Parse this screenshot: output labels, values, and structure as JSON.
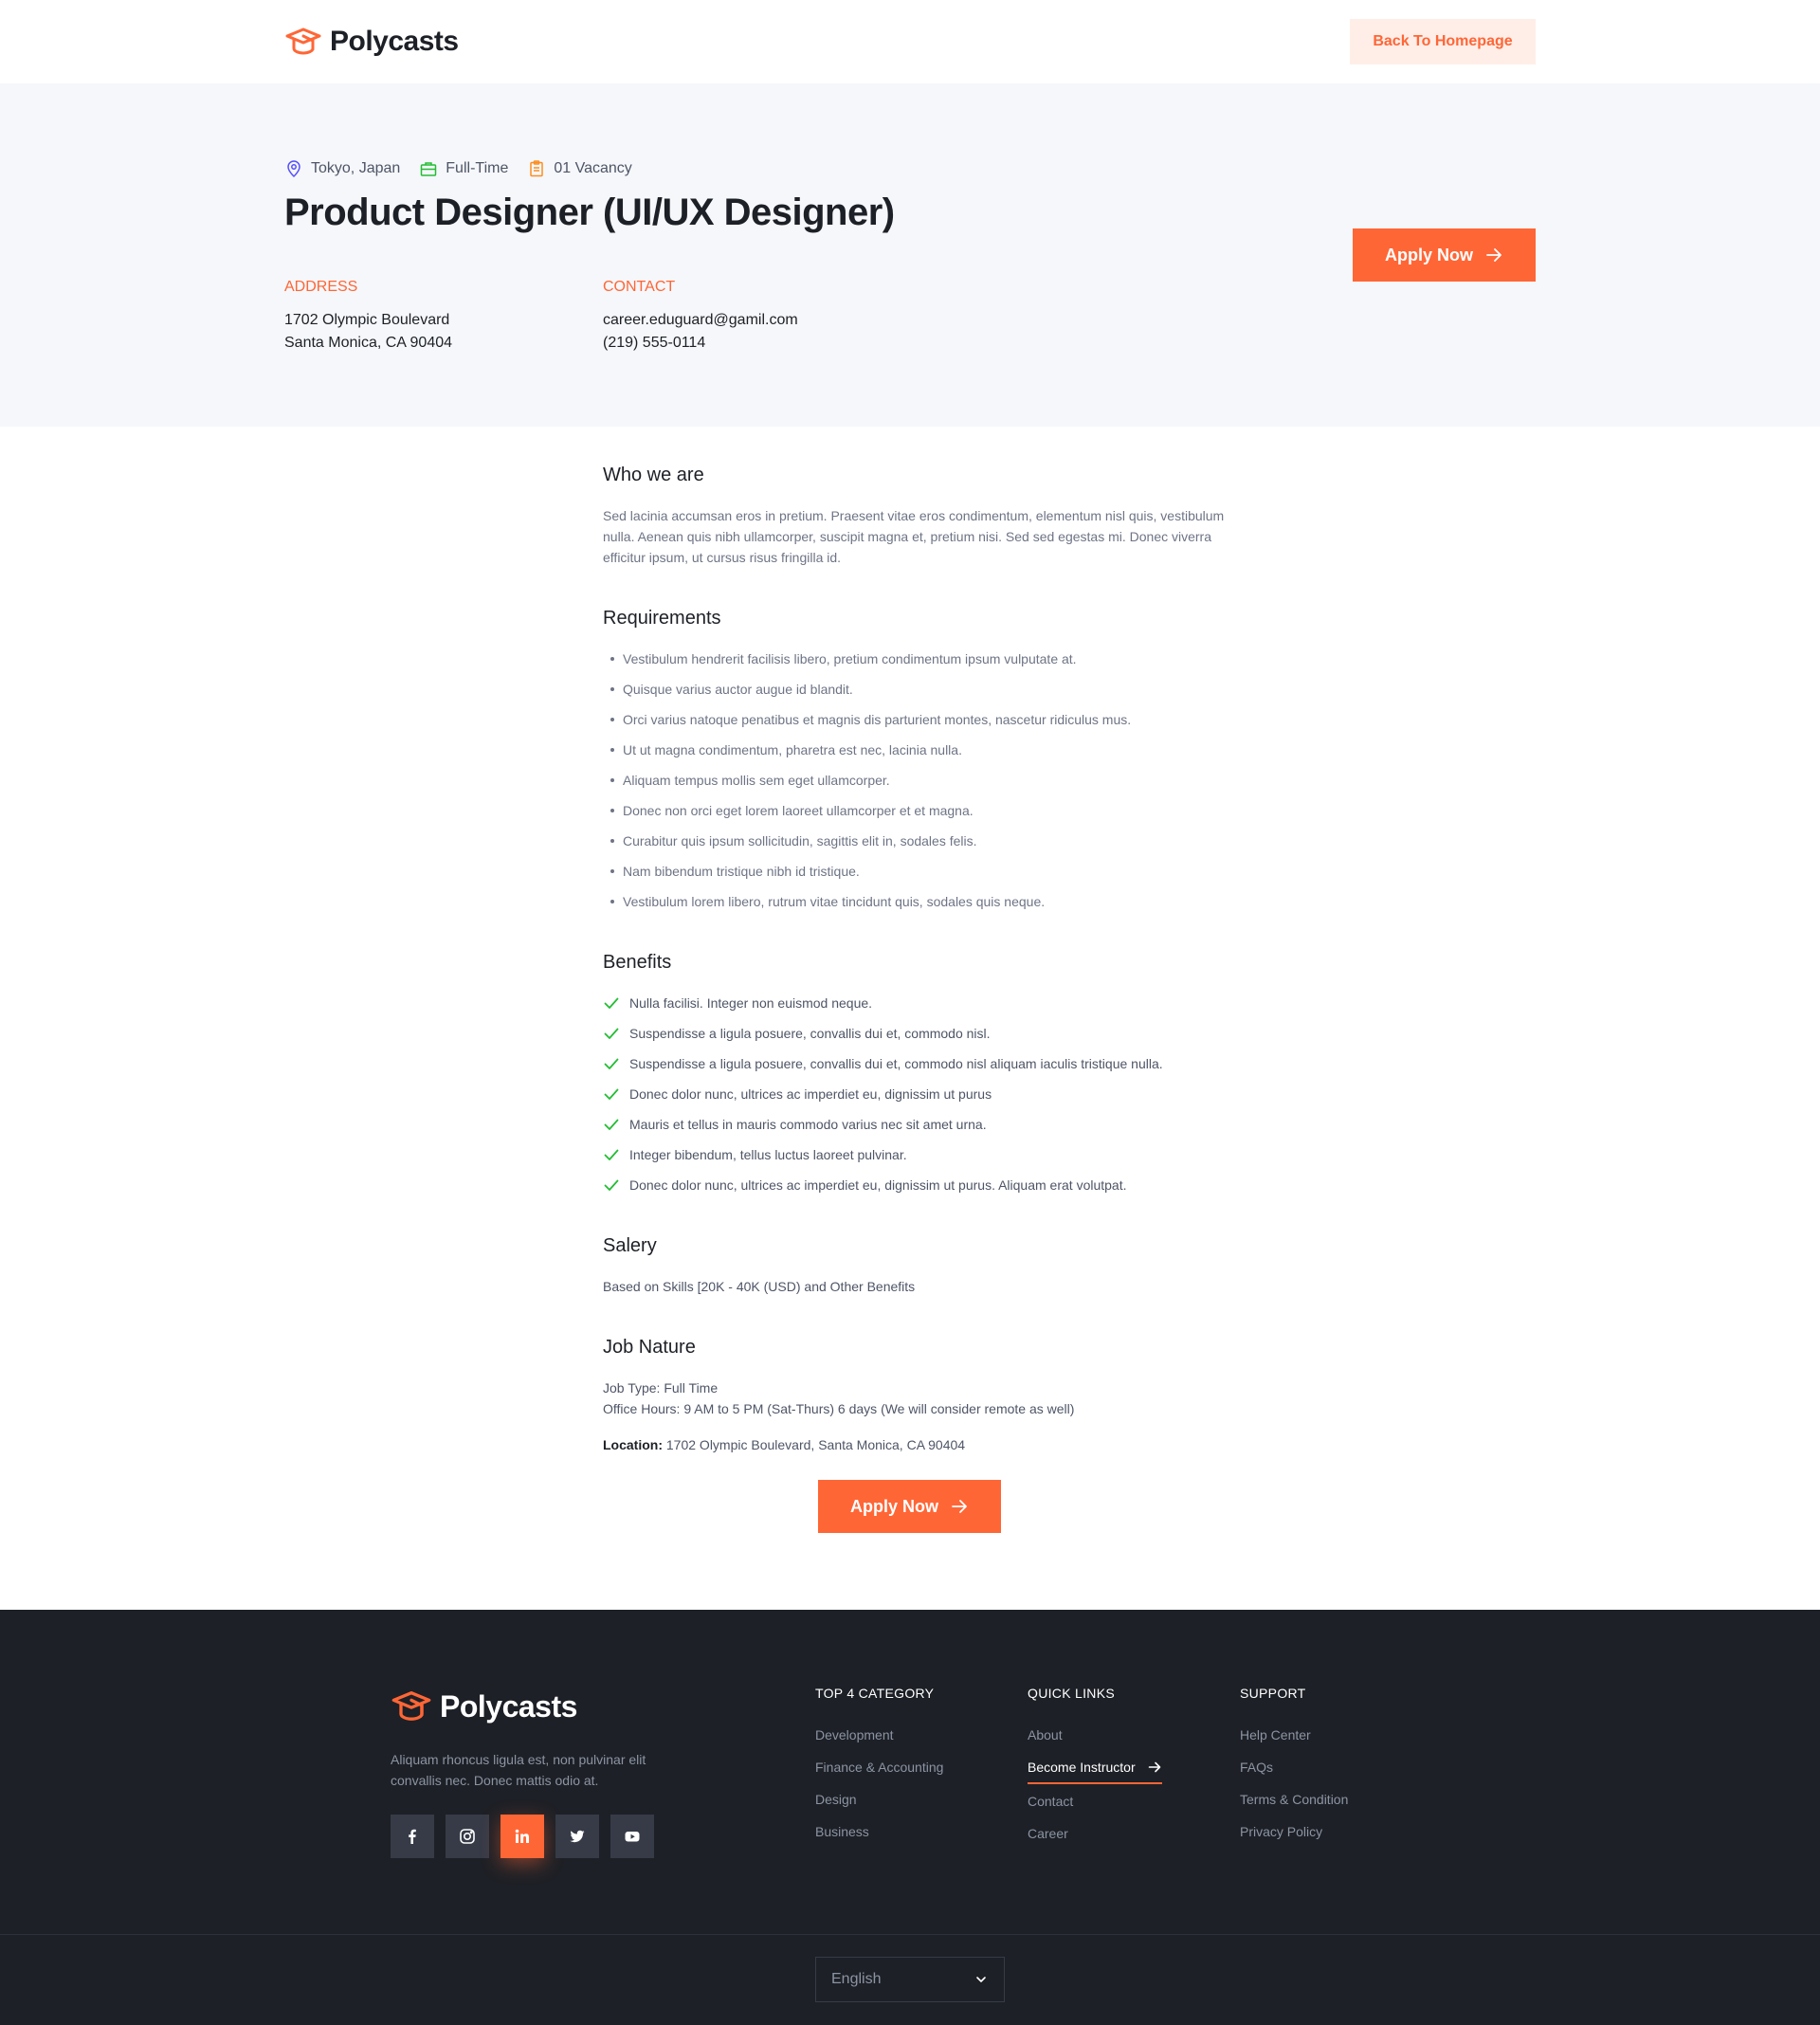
{
  "brand": {
    "name": "Polycasts",
    "accent": "#ff6636"
  },
  "header": {
    "back_label": "Back To Homepage"
  },
  "job": {
    "location": "Tokyo, Japan",
    "type": "Full-Time",
    "vacancy": "01 Vacancy",
    "title": "Product Designer (UI/UX Designer)",
    "address_label": "ADDRESS",
    "address_line1": "1702 Olympic Boulevard",
    "address_line2": "Santa Monica, CA 90404",
    "contact_label": "CONTACT",
    "email": "career.eduguard@gamil.com",
    "phone": "(219) 555-0114",
    "apply_label": "Apply Now"
  },
  "content": {
    "who_title": "Who we are",
    "who_text": "Sed lacinia accumsan eros in pretium. Praesent vitae eros condimentum, elementum nisl quis, vestibulum nulla. Aenean quis nibh ullamcorper, suscipit magna et, pretium nisi. Sed sed egestas mi. Donec viverra efficitur ipsum, ut cursus risus fringilla id.",
    "req_title": "Requirements",
    "requirements": [
      "Vestibulum hendrerit facilisis libero, pretium condimentum ipsum vulputate at.",
      "Quisque varius auctor augue id blandit.",
      "Orci varius natoque penatibus et magnis dis parturient montes, nascetur ridiculus mus.",
      "Ut ut magna condimentum, pharetra est nec, lacinia nulla.",
      "Aliquam tempus mollis sem eget ullamcorper.",
      "Donec non orci eget lorem laoreet ullamcorper et et magna.",
      "Curabitur quis ipsum sollicitudin, sagittis elit in, sodales felis.",
      "Nam bibendum tristique nibh id tristique.",
      "Vestibulum lorem libero, rutrum vitae tincidunt quis, sodales quis neque."
    ],
    "ben_title": "Benefits",
    "benefits": [
      "Nulla facilisi. Integer non euismod neque.",
      "Suspendisse a ligula posuere, convallis dui et, commodo nisl.",
      "Suspendisse a ligula posuere, convallis dui et, commodo nisl aliquam iaculis tristique nulla.",
      "Donec dolor nunc, ultrices ac imperdiet eu, dignissim ut purus",
      "Mauris et tellus in mauris commodo varius nec sit amet urna.",
      "Integer bibendum, tellus luctus laoreet pulvinar.",
      "Donec dolor nunc, ultrices ac imperdiet eu, dignissim ut purus. Aliquam erat volutpat."
    ],
    "salary_title": "Salery",
    "salary_text": "Based on Skills [20K - 40K (USD) and Other Benefits",
    "nature_title": "Job Nature",
    "job_type": "Job Type: Full Time",
    "office_hours": "Office Hours: 9 AM to 5 PM (Sat-Thurs) 6 days (We will consider remote as well)",
    "location_label": "Location:",
    "location_value": " 1702 Olympic Boulevard, Santa Monica, CA 90404"
  },
  "footer": {
    "desc": "Aliquam rhoncus ligula est, non pulvinar elit convallis nec. Donec mattis odio at.",
    "col1_title": "TOP 4 CATEGORY",
    "col1_links": [
      "Development",
      "Finance & Accounting",
      "Design",
      "Business"
    ],
    "col2_title": "QUICK LINKS",
    "col2_links": [
      "About",
      "Become Instructor",
      "Contact",
      "Career"
    ],
    "col3_title": "SUPPORT",
    "col3_links": [
      "Help Center",
      "FAQs",
      "Terms & Condition",
      "Privacy Policy"
    ],
    "language": "English",
    "socials": [
      "facebook-icon",
      "instagram-icon",
      "linkedin-icon",
      "twitter-icon",
      "youtube-icon"
    ]
  }
}
